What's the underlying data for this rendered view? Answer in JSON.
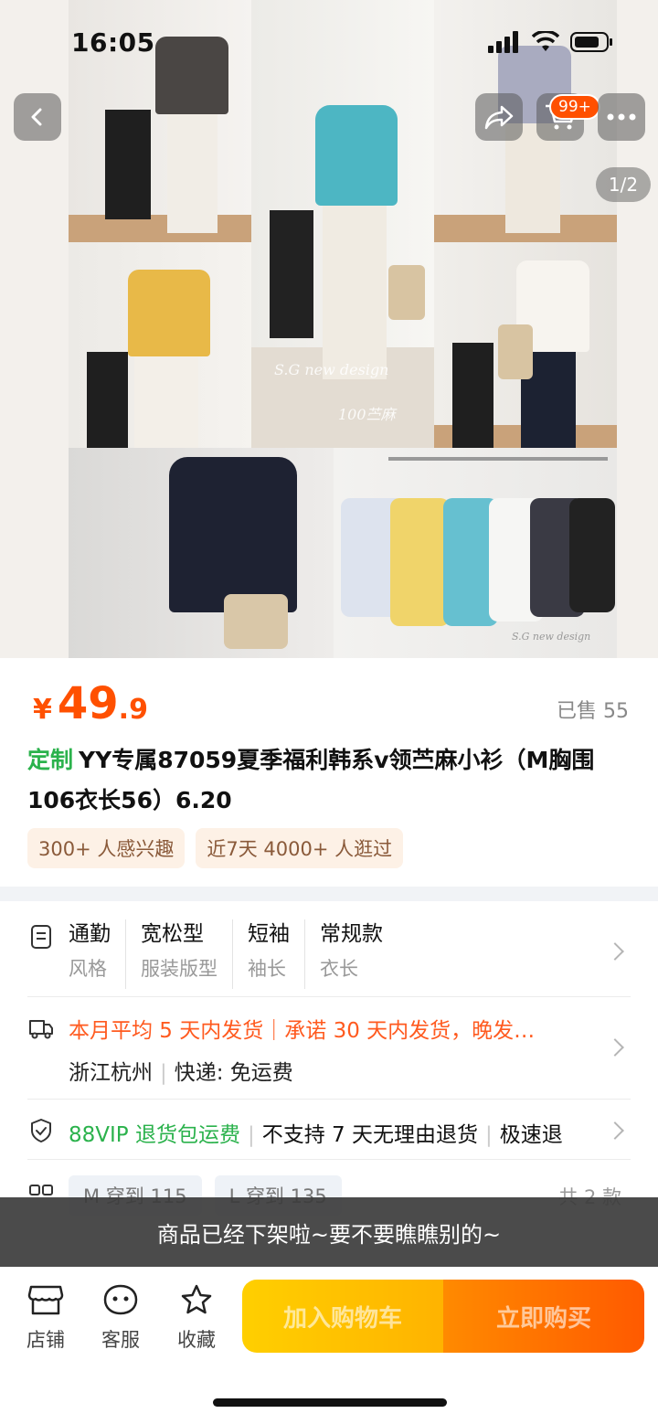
{
  "status_bar": {
    "time": "16:05"
  },
  "gallery": {
    "cart_badge": "99+",
    "page_indicator": "1/2",
    "watermark_brand": "S.G new design",
    "watermark_tag": "100苎麻",
    "watermark_small": "S.G new design"
  },
  "product": {
    "price_currency": "¥",
    "price_integer": "49",
    "price_decimal": ".9",
    "sold_label": "已售 55",
    "title_tag": "定制",
    "title": "YY专属87059夏季福利韩系v领苎麻小衫（M胸围106衣长56）6.20",
    "chips": [
      "300+ 人感兴趣",
      "近7天 4000+ 人逛过"
    ]
  },
  "specs": [
    {
      "value": "通勤",
      "key": "风格"
    },
    {
      "value": "宽松型",
      "key": "服装版型"
    },
    {
      "value": "短袖",
      "key": "袖长"
    },
    {
      "value": "常规款",
      "key": "衣长"
    }
  ],
  "shipping": {
    "line1": "本月平均 5 天内发货｜承诺 30 天内发货，晚发…",
    "location": "浙江杭州",
    "express": "快递: 免运费"
  },
  "service": {
    "vip": "88VIP 退货包运费",
    "no_return": "不支持 7 天无理由退货",
    "fast": "极速退"
  },
  "sizes": {
    "options": [
      "M 穿到 115",
      "L 穿到 135"
    ],
    "count": "共 2 款"
  },
  "toast": "商品已经下架啦~要不要瞧瞧别的~",
  "bottom_bar": {
    "store": "店铺",
    "service": "客服",
    "favorite": "收藏",
    "add_cart": "加入购物车",
    "buy_now": "立即购买"
  },
  "colors": {
    "accent": "#ff5000",
    "green": "#2bb24c"
  }
}
